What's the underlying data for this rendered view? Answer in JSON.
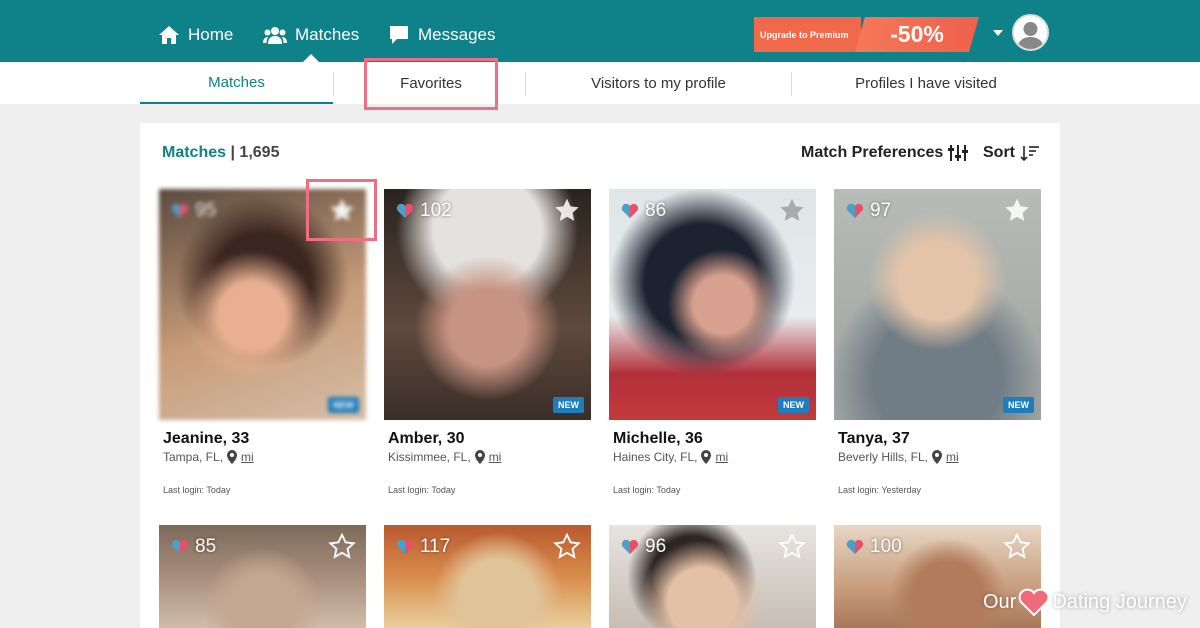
{
  "nav": {
    "home": "Home",
    "matches": "Matches",
    "messages": "Messages",
    "premium_label": "Upgrade to Premium",
    "premium_discount": "-50%"
  },
  "tabs": [
    {
      "label": "Matches"
    },
    {
      "label": "Favorites"
    },
    {
      "label": "Visitors to my profile"
    },
    {
      "label": "Profiles I have visited"
    }
  ],
  "summary": {
    "label": "Matches",
    "separator": "|",
    "count": "1,695"
  },
  "toolbar": {
    "preferences": "Match Preferences",
    "sort": "Sort"
  },
  "profiles": [
    {
      "score": "95",
      "name": "Jeanine, 33",
      "location": "Tampa, FL,",
      "distance": "mi",
      "last_login": "Last login: Today",
      "badge": "NEW"
    },
    {
      "score": "102",
      "name": "Amber, 30",
      "location": "Kissimmee, FL,",
      "distance": "mi",
      "last_login": "Last login: Today",
      "badge": "NEW"
    },
    {
      "score": "86",
      "name": "Michelle, 36",
      "location": "Haines City, FL,",
      "distance": "mi",
      "last_login": "Last login: Today",
      "badge": "NEW"
    },
    {
      "score": "97",
      "name": "Tanya, 37",
      "location": "Beverly Hills, FL,",
      "distance": "mi",
      "last_login": "Last login: Yesterday",
      "badge": "NEW"
    },
    {
      "score": "85"
    },
    {
      "score": "117"
    },
    {
      "score": "96"
    },
    {
      "score": "100"
    }
  ],
  "watermark": {
    "left": "Our",
    "right": "Dating Journey"
  },
  "colors": {
    "brand": "#0e8189",
    "highlight": "#ec6f86",
    "new_badge": "#1f7dbd",
    "premium": "#f0694a"
  }
}
